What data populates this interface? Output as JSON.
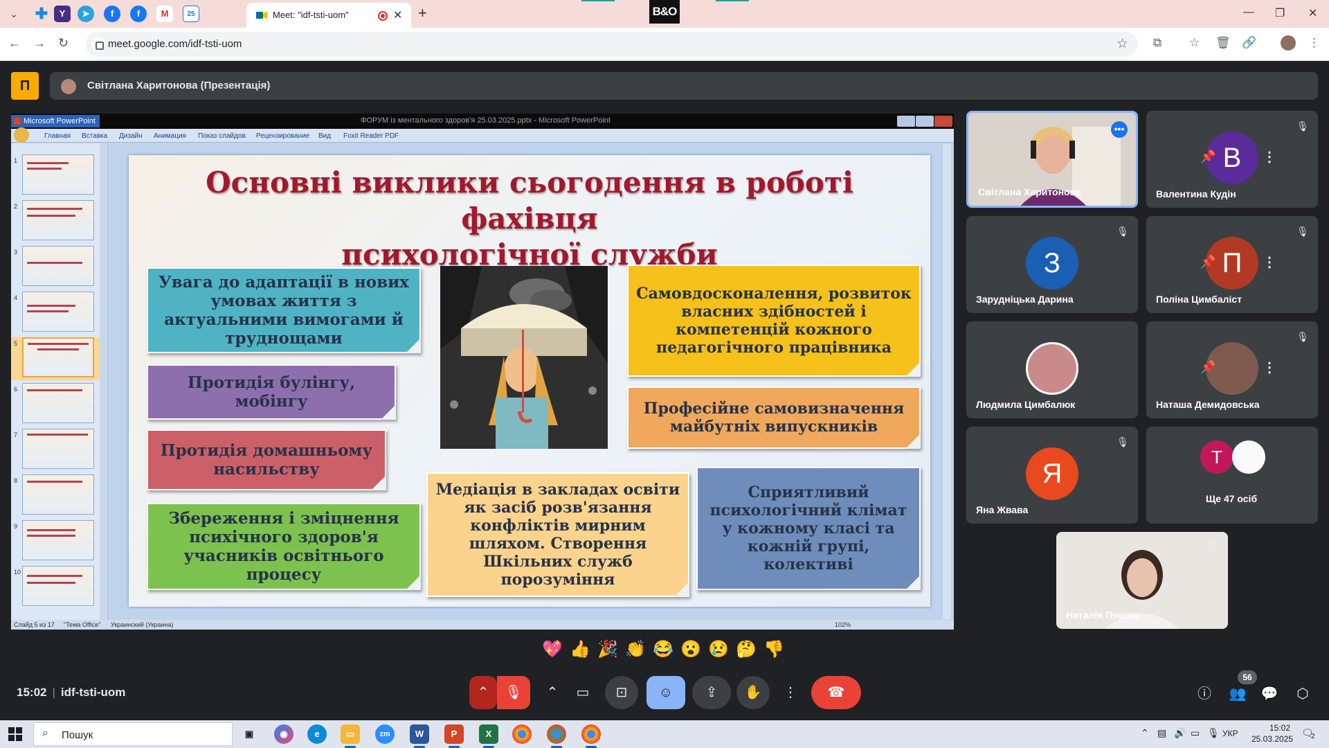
{
  "browser": {
    "tab_title": "Meet: \"idf-tsti-uom\"",
    "url": "meet.google.com/idf-tsti-uom",
    "center_logo": "B&O"
  },
  "meet": {
    "presenter_label": "Світлана Харитонова (Презентація)",
    "meeting_code": "idf-tsti-uom",
    "time": "15:02",
    "participant_count": "56"
  },
  "ppt": {
    "app_name": "Microsoft PowerPoint",
    "doc_title": "ФОРУМ із ментального здоров'я 25.03.2025.pptx - Microsoft PowerPoint",
    "ribbon_tabs": [
      "Главная",
      "Вставка",
      "Дизайн",
      "Анимация",
      "Показ слайдов",
      "Рецензирование",
      "Вид",
      "Foxit Reader PDF"
    ],
    "status": {
      "slide": "Слайд 5 из 17",
      "theme": "\"Тема Office\"",
      "lang": "Украинский (Украина)",
      "zoom": "102%"
    },
    "thumbnails": [
      "1",
      "2",
      "3",
      "4",
      "5",
      "6",
      "7",
      "8",
      "9",
      "10"
    ],
    "selected_slide": 5
  },
  "slide": {
    "title_line1": "Основні виклики сьогодення в роботі фахівця",
    "title_line2": "психологічної служби",
    "notes": {
      "n1": "Увага до адаптації в нових умовах життя з актуальними вимогами й труднощами",
      "n2": "Протидія булінгу, мобінгу",
      "n3": "Протидія домашньому насильству",
      "n4": "Збереження і зміцнення психічного здоров'я учасників освітнього процесу",
      "n5": "Медіація в закладах освіти як засіб розв'язання конфліктів мирним шляхом. Створення Шкільних служб порозуміння",
      "n6": "Самовдосконалення, розвиток власних здібностей і компетенцій кожного педагогічного працівника",
      "n7": "Професійне самовизначення майбутніх випускників",
      "n8": "Сприятливий психологічний клімат у кожному класі та кожній групі, колективі"
    }
  },
  "participants": {
    "p1": {
      "name": "Світлана Харитонова"
    },
    "p2": {
      "name": "Валентина Кудін",
      "initial": "В",
      "color": "#5b2b9c"
    },
    "p3": {
      "name": "Зарудніцька Дарина",
      "initial": "З",
      "color": "#1a5fb4"
    },
    "p4": {
      "name": "Поліна Цимбаліст",
      "initial": "П",
      "color": "#b23a24"
    },
    "p5": {
      "name": "Людмила Цимбалюк"
    },
    "p6": {
      "name": "Наташа Демидовська"
    },
    "p7": {
      "name": "Яна Жвава",
      "initial": "Я",
      "color": "#e8491d"
    },
    "p8": {
      "name": "Ще 47 осіб",
      "initial": "Т",
      "color": "#c2185b"
    },
    "p9": {
      "name": "Наталія Пишна"
    }
  },
  "reactions": [
    "💖",
    "👍",
    "🎉",
    "👏",
    "😂",
    "😮",
    "😢",
    "🤔",
    "👎"
  ],
  "taskbar": {
    "search_placeholder": "Пошук",
    "lang": "УКР",
    "time": "15:02",
    "date": "25.03.2025",
    "notif_count": "2"
  }
}
